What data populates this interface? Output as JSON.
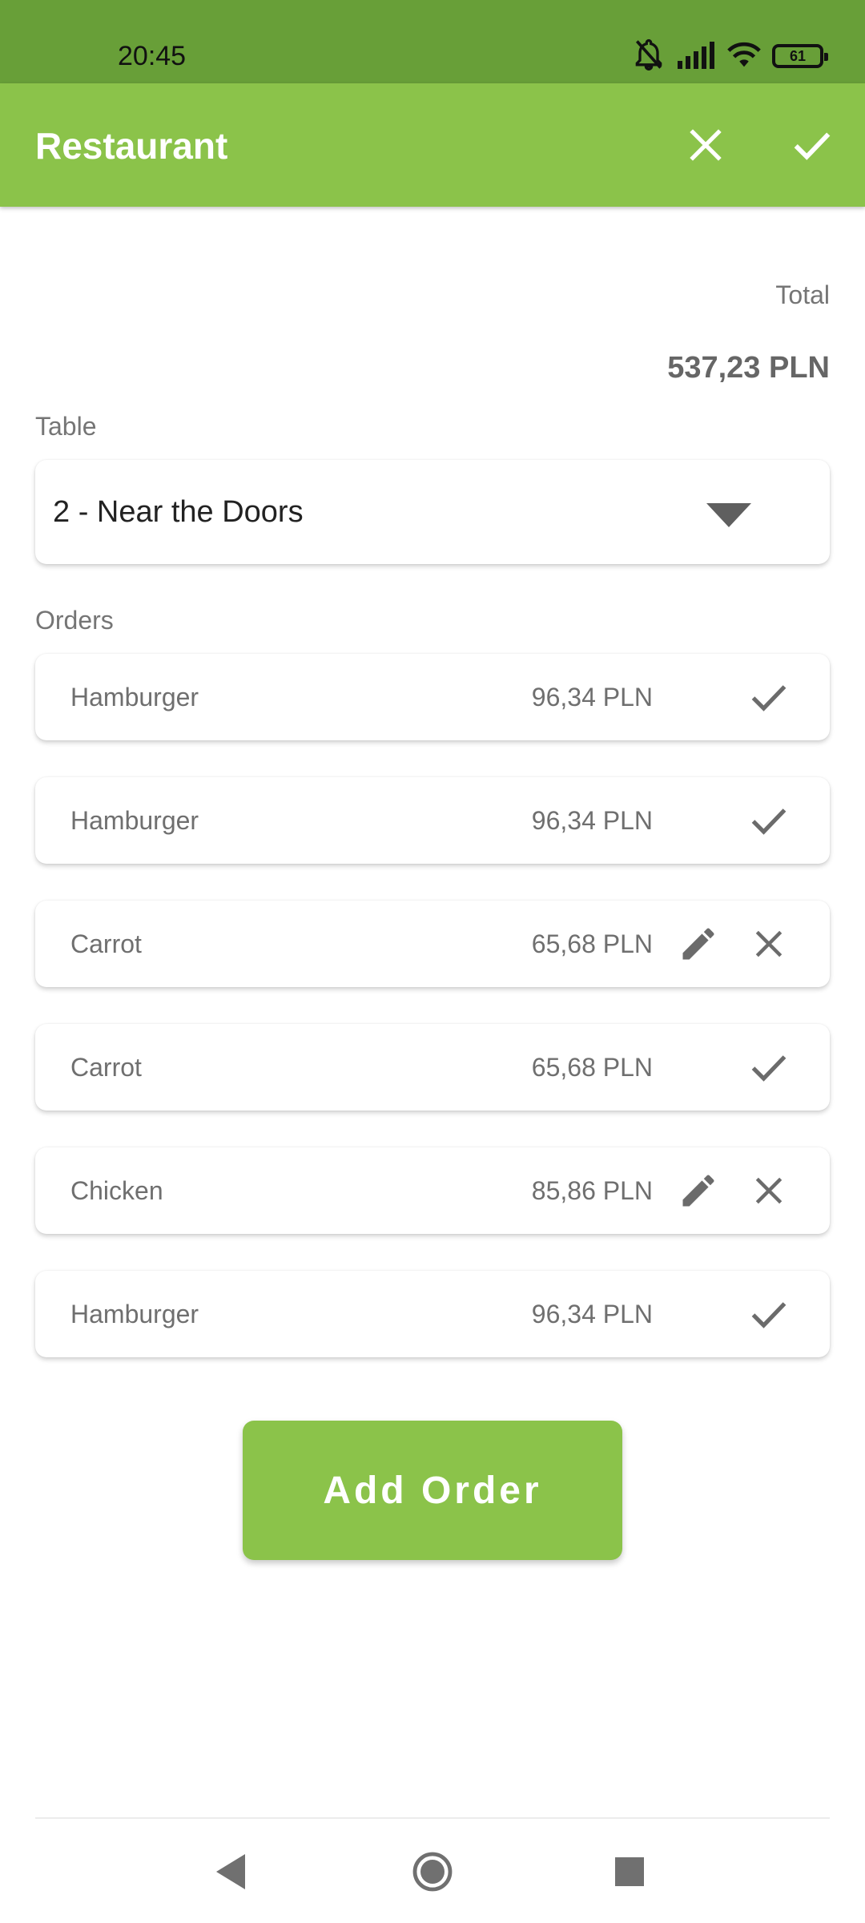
{
  "status_bar": {
    "time": "20:45",
    "battery_level": "61",
    "icons": [
      "mute-icon",
      "signal-icon",
      "wifi-icon",
      "battery-icon"
    ]
  },
  "app_bar": {
    "title": "Restaurant",
    "actions": [
      "close-icon",
      "check-icon"
    ],
    "background_color": "#8bc34a"
  },
  "summary": {
    "total_label": "Total",
    "total_value": "537,23 PLN"
  },
  "table": {
    "label": "Table",
    "selected": "2 - Near the Doors"
  },
  "orders": {
    "label": "Orders",
    "items": [
      {
        "name": "Hamburger",
        "price": "96,34 PLN",
        "status": "done"
      },
      {
        "name": "Hamburger",
        "price": "96,34 PLN",
        "status": "done"
      },
      {
        "name": "Carrot",
        "price": "65,68 PLN",
        "status": "pending"
      },
      {
        "name": "Carrot",
        "price": "65,68 PLN",
        "status": "done"
      },
      {
        "name": "Chicken",
        "price": "85,86 PLN",
        "status": "pending"
      },
      {
        "name": "Hamburger",
        "price": "96,34 PLN",
        "status": "done"
      }
    ]
  },
  "add_order_button": {
    "label": "Add Order",
    "color": "#8bc34a"
  },
  "nav_bar": {
    "buttons": [
      "back-icon",
      "home-icon",
      "recents-icon"
    ]
  }
}
